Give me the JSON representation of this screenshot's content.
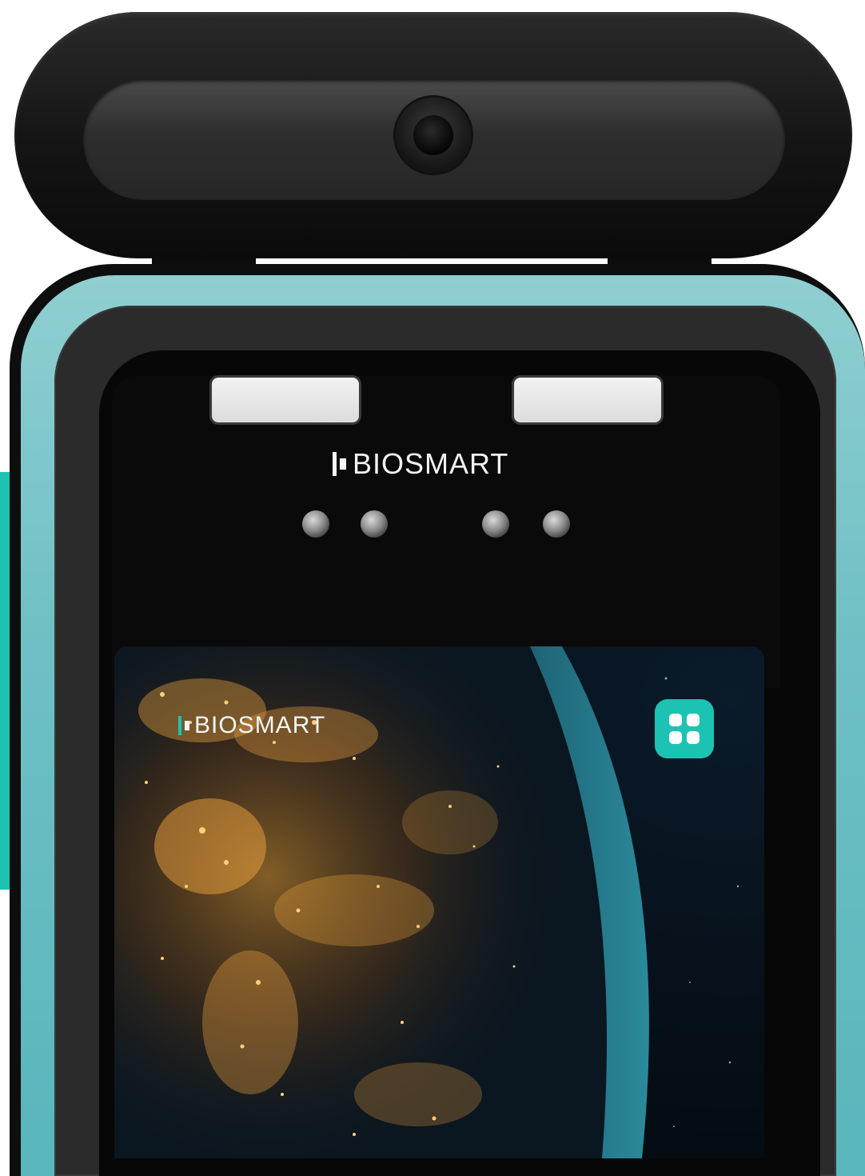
{
  "device": {
    "brand_top": "BIOSMART"
  },
  "screen": {
    "brand_label": "BIOSMART",
    "menu_icon": "grid-icon"
  },
  "colors": {
    "accent": "#1cc3b2",
    "frame_glow": "#6fc0c4",
    "body": "#0e0e0e"
  }
}
